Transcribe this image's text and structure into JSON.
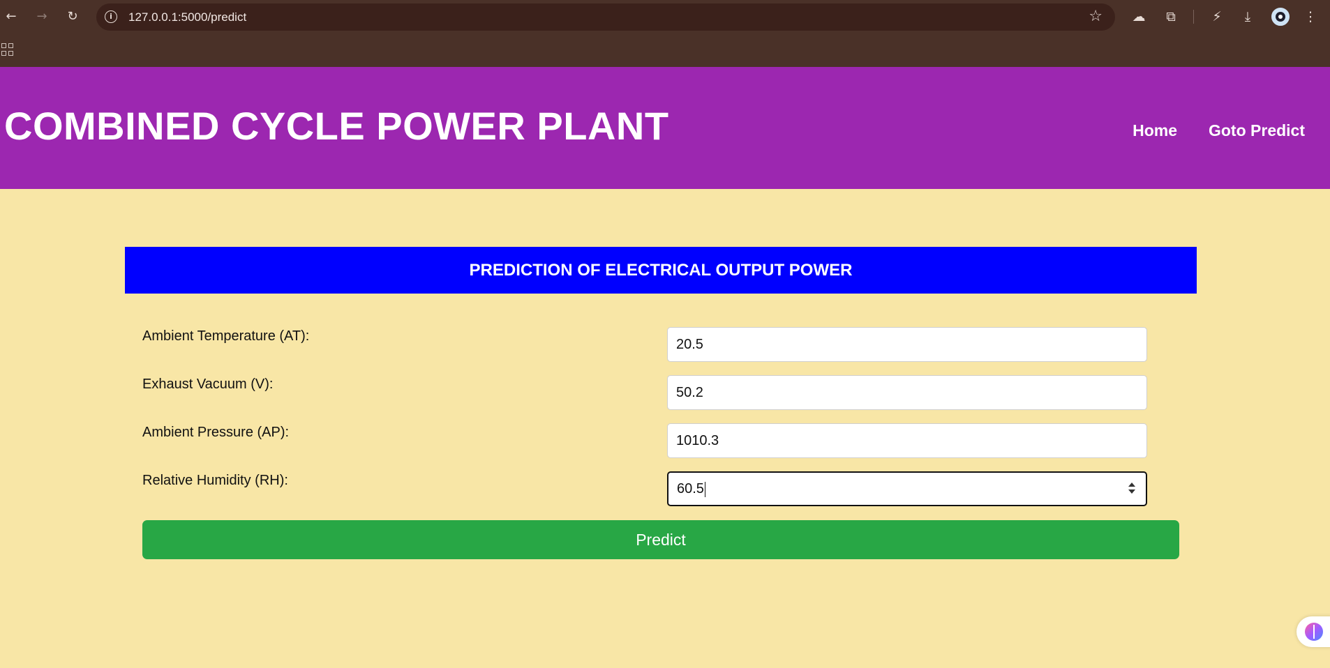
{
  "browser": {
    "url": "127.0.0.1:5000/predict",
    "back_glyph": "←",
    "forward_glyph": "→",
    "reload_glyph": "↻",
    "star_glyph": "☆",
    "menu_glyph": "⋮",
    "download_glyph": "⤓",
    "extensions_glyph": "⧉"
  },
  "header": {
    "title": "COMBINED CYCLE POWER PLANT",
    "nav": [
      {
        "label": "Home"
      },
      {
        "label": "Goto Predict"
      }
    ],
    "background": "#9c27b0"
  },
  "form": {
    "heading": "PREDICTION OF ELECTRICAL OUTPUT POWER",
    "heading_background": "#0000ff",
    "fields": [
      {
        "label": "Ambient Temperature (AT):",
        "value": "20.5"
      },
      {
        "label": "Exhaust Vacuum (V):",
        "value": "50.2"
      },
      {
        "label": "Ambient Pressure (AP):",
        "value": "1010.3"
      },
      {
        "label": "Relative Humidity (RH):",
        "value": "60.5"
      }
    ],
    "submit_label": "Predict",
    "submit_color": "#28a745"
  },
  "page": {
    "background": "#f8e6a6"
  }
}
